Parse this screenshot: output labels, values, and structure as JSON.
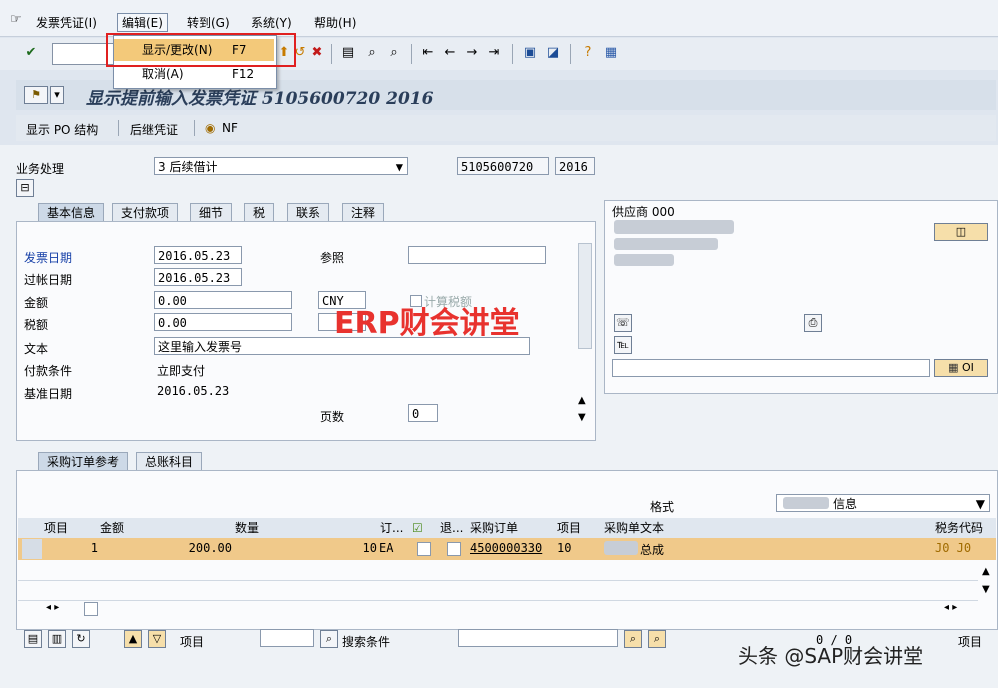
{
  "menu": {
    "invoice": "发票凭证(I)",
    "edit": "编辑(E)",
    "goto": "转到(G)",
    "system": "系统(Y)",
    "help": "帮助(H)"
  },
  "edit_menu": [
    {
      "label": "显示/更改(N)",
      "key": "F7"
    },
    {
      "label": "取消(A)",
      "key": "F12"
    }
  ],
  "title": "显示提前输入发票凭证 5105600720 2016",
  "app_toolbar": {
    "show_po": "显示 PO 结构",
    "follow_doc": "后继凭证",
    "nf": "NF"
  },
  "header": {
    "transaction_label": "业务处理",
    "transaction_value": "3 后续借计",
    "doc_number": "5105600720",
    "year": "2016"
  },
  "tabs": [
    "基本信息",
    "支付款项",
    "细节",
    "税",
    "联系",
    "注释"
  ],
  "basic": {
    "invoice_date_label": "发票日期",
    "invoice_date": "2016.05.23",
    "reference_label": "参照",
    "posting_date_label": "过帐日期",
    "posting_date": "2016.05.23",
    "amount_label": "金额",
    "amount": "0.00",
    "currency": "CNY",
    "calc_tax": "计算税额",
    "tax_label": "税额",
    "tax": "0.00",
    "text_label": "文本",
    "text": "这里输入发票号",
    "payterm_label": "付款条件",
    "payterm": "立即支付",
    "baseline_label": "基准日期",
    "baseline": "2016.05.23",
    "pages_label": "页数",
    "pages": "0"
  },
  "vendor": {
    "label": "供应商 000",
    "oi": "OI"
  },
  "bottom_tabs": [
    "采购订单参考",
    "总账科目"
  ],
  "layout_label": "格式",
  "layout_value": "信息",
  "grid": {
    "columns": [
      "项目",
      "金额",
      "数量",
      "订...",
      "退...",
      "采购订单",
      "项目",
      "采购单文本",
      "税务代码"
    ],
    "row": {
      "item": "1",
      "amount": "200.00",
      "qty": "10",
      "unit": "EA",
      "po": "4500000330",
      "po_item": "10",
      "text": "总成",
      "tax": "J0 J0"
    }
  },
  "footer": {
    "item_label": "项目",
    "search_label": "搜索条件",
    "counter": "0 / 0",
    "items_right": "项目"
  },
  "watermark": "ERP财会讲堂",
  "footer_watermark": "头条 @SAP财会讲堂",
  "colors": {
    "accent_orange": "#f0c98a",
    "highlight_red": "#e02020",
    "watermark_red": "#e8322e"
  }
}
